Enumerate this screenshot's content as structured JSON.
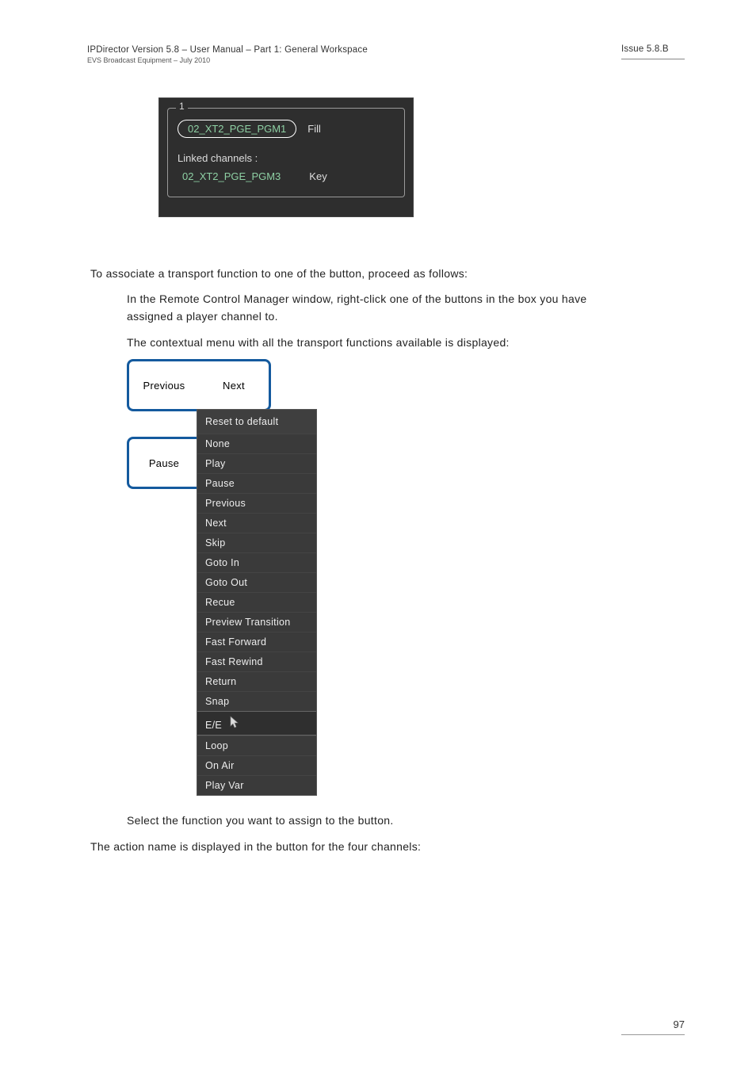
{
  "header": {
    "title_left": "IPDirector Version 5.8 – User Manual – Part 1: General Workspace",
    "subtitle_left": "EVS Broadcast Equipment  –  July 2010",
    "title_right": "Issue 5.8.B"
  },
  "channel_panel": {
    "frame_label": "1",
    "main_channel": "02_XT2_PGE_PGM1",
    "main_role": "Fill",
    "linked_label": "Linked channels :",
    "linked_channel": "02_XT2_PGE_PGM3",
    "linked_role": "Key"
  },
  "paragraphs": {
    "intro": "To associate a transport function to one of the button, proceed as follows:",
    "step1": "In the Remote Control Manager window, right-click one of the buttons in the box you have assigned a player channel to.",
    "step1b": "The contextual menu with all the transport functions available is displayed:",
    "step2": "Select the function you want to assign to the button.",
    "result": "The action name is displayed in the button for the four channels:"
  },
  "buttons": {
    "previous": "Previous",
    "next": "Next",
    "pause": "Pause"
  },
  "context_menu": {
    "items": [
      "Reset to default",
      "None",
      "Play",
      "Pause",
      "Previous",
      "Next",
      "Skip",
      "Goto In",
      "Goto Out",
      "Recue",
      "Preview Transition",
      "Fast Forward",
      "Fast Rewind",
      "Return",
      "Snap",
      "E/E",
      "Loop",
      "On Air",
      "Play Var"
    ],
    "highlight_index": 15
  },
  "footer": {
    "page": "97"
  }
}
